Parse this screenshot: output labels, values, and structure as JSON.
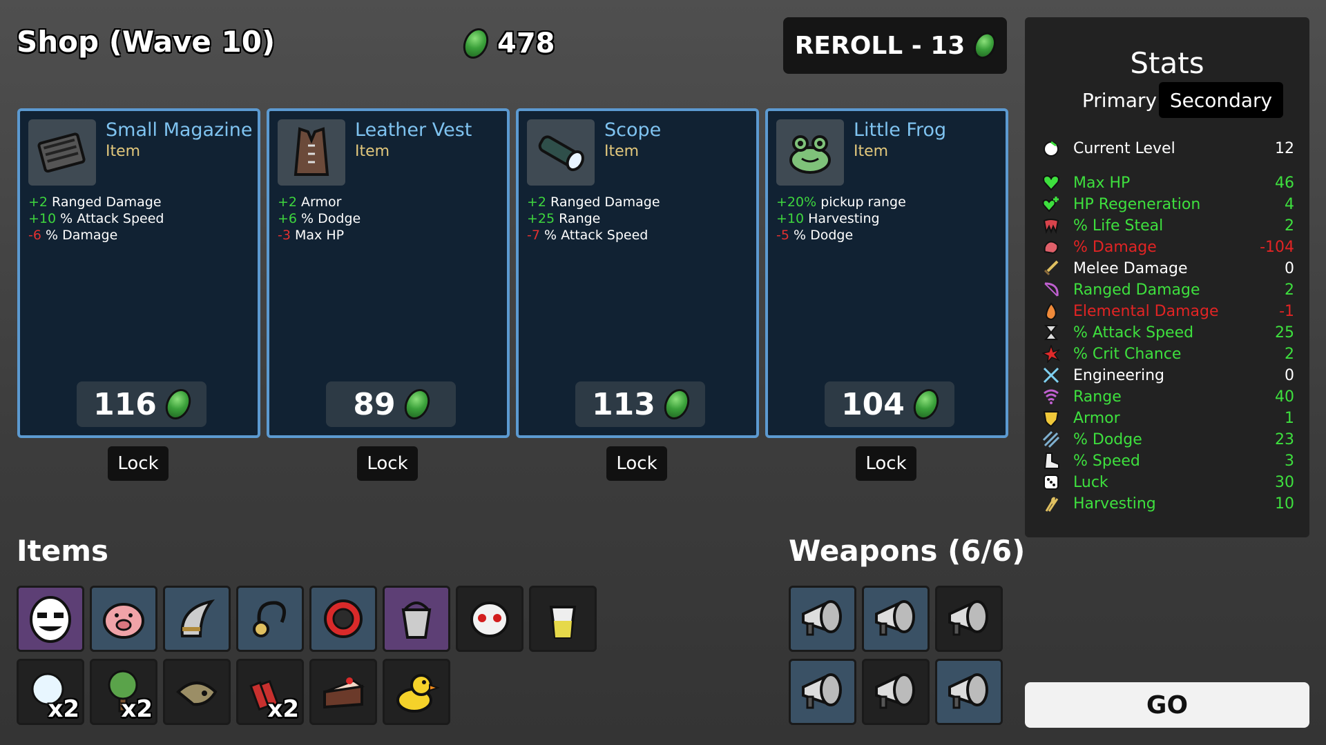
{
  "header": {
    "title": "Shop (Wave 10)",
    "gold": "478",
    "reroll_label": "REROLL - 13"
  },
  "cards": [
    {
      "name": "Small Magazine",
      "type": "Item",
      "price": "116",
      "lock_label": "Lock",
      "icon": "magazine-icon",
      "stats": [
        {
          "value": "+2",
          "sign": "pos",
          "text": " Ranged Damage"
        },
        {
          "value": "+10",
          "sign": "pos",
          "text": " % Attack Speed"
        },
        {
          "value": "-6",
          "sign": "neg",
          "text": " % Damage"
        }
      ]
    },
    {
      "name": "Leather Vest",
      "type": "Item",
      "price": "89",
      "lock_label": "Lock",
      "icon": "vest-icon",
      "stats": [
        {
          "value": "+2",
          "sign": "pos",
          "text": " Armor"
        },
        {
          "value": "+6",
          "sign": "pos",
          "text": " % Dodge"
        },
        {
          "value": "-3",
          "sign": "neg",
          "text": " Max HP"
        }
      ]
    },
    {
      "name": "Scope",
      "type": "Item",
      "price": "113",
      "lock_label": "Lock",
      "icon": "scope-icon",
      "stats": [
        {
          "value": "+2",
          "sign": "pos",
          "text": " Ranged Damage"
        },
        {
          "value": "+25",
          "sign": "pos",
          "text": " Range"
        },
        {
          "value": "-7",
          "sign": "neg",
          "text": " % Attack Speed"
        }
      ]
    },
    {
      "name": "Little Frog",
      "type": "Item",
      "price": "104",
      "lock_label": "Lock",
      "icon": "frog-icon",
      "stats": [
        {
          "value": "+20%",
          "sign": "pos",
          "text": " pickup range"
        },
        {
          "value": "+10",
          "sign": "pos",
          "text": " Harvesting"
        },
        {
          "value": "-5",
          "sign": "neg",
          "text": " % Dodge"
        }
      ]
    }
  ],
  "items_section": {
    "label": "Items",
    "items": [
      {
        "icon": "egg-face-icon",
        "tier": "purple",
        "count": ""
      },
      {
        "icon": "piggy-bank-icon",
        "tier": "blue",
        "count": ""
      },
      {
        "icon": "helmet-icon",
        "tier": "blue",
        "count": ""
      },
      {
        "icon": "pendant-icon",
        "tier": "blue",
        "count": ""
      },
      {
        "icon": "ring-target-icon",
        "tier": "blue",
        "count": ""
      },
      {
        "icon": "bucket-icon",
        "tier": "purple",
        "count": ""
      },
      {
        "icon": "mask-icon",
        "tier": "base",
        "count": ""
      },
      {
        "icon": "cup-icon",
        "tier": "base",
        "count": ""
      },
      {
        "icon": "snowball-icon",
        "tier": "base",
        "count": "x2"
      },
      {
        "icon": "tree-icon",
        "tier": "base",
        "count": "x2"
      },
      {
        "icon": "hat-creature-icon",
        "tier": "base",
        "count": ""
      },
      {
        "icon": "dynamite-icon",
        "tier": "base",
        "count": "x2"
      },
      {
        "icon": "cake-icon",
        "tier": "base",
        "count": ""
      },
      {
        "icon": "duck-icon",
        "tier": "base",
        "count": ""
      }
    ]
  },
  "weapons_section": {
    "label": "Weapons (6/6)",
    "weapons": [
      {
        "icon": "megaphone-gun-icon",
        "tier": "blue"
      },
      {
        "icon": "megaphone-gun-icon",
        "tier": "blue"
      },
      {
        "icon": "megaphone-gun-icon",
        "tier": "base"
      },
      {
        "icon": "megaphone-gun-icon",
        "tier": "blue"
      },
      {
        "icon": "megaphone-gun-icon",
        "tier": "base"
      },
      {
        "icon": "megaphone-gun-icon",
        "tier": "blue"
      }
    ]
  },
  "stats_panel": {
    "title": "Stats",
    "tab_primary": "Primary",
    "tab_secondary": "Secondary",
    "rows": [
      {
        "label": "Current Level",
        "value": "12",
        "color": "white",
        "icon": "level-icon"
      },
      {
        "label": "Max HP",
        "value": "46",
        "color": "green",
        "icon": "heart-icon"
      },
      {
        "label": "HP Regeneration",
        "value": "4",
        "color": "green",
        "icon": "heart-plus-icon"
      },
      {
        "label": "% Life Steal",
        "value": "2",
        "color": "green",
        "icon": "fangs-icon"
      },
      {
        "label": "% Damage",
        "value": "-104",
        "color": "red",
        "icon": "muscle-icon"
      },
      {
        "label": "Melee Damage",
        "value": "0",
        "color": "white",
        "icon": "sword-icon"
      },
      {
        "label": "Ranged Damage",
        "value": "2",
        "color": "green",
        "icon": "bow-icon"
      },
      {
        "label": "Elemental Damage",
        "value": "-1",
        "color": "red",
        "icon": "flame-icon"
      },
      {
        "label": "% Attack Speed",
        "value": "25",
        "color": "green",
        "icon": "hourglass-icon"
      },
      {
        "label": "% Crit Chance",
        "value": "2",
        "color": "green",
        "icon": "crit-icon"
      },
      {
        "label": "Engineering",
        "value": "0",
        "color": "white",
        "icon": "wrench-icon"
      },
      {
        "label": "Range",
        "value": "40",
        "color": "green",
        "icon": "range-icon"
      },
      {
        "label": "Armor",
        "value": "1",
        "color": "green",
        "icon": "shield-icon"
      },
      {
        "label": "% Dodge",
        "value": "23",
        "color": "green",
        "icon": "dodge-icon"
      },
      {
        "label": "% Speed",
        "value": "3",
        "color": "green",
        "icon": "boot-icon"
      },
      {
        "label": "Luck",
        "value": "30",
        "color": "green",
        "icon": "dice-icon"
      },
      {
        "label": "Harvesting",
        "value": "10",
        "color": "green",
        "icon": "wheat-icon"
      }
    ]
  },
  "go_label": "GO",
  "colors": {
    "card_border": "#5c9ad1",
    "card_bg": "#112233",
    "positive": "#3ed63e",
    "negative": "#e23030",
    "item_name": "#7fc3f0",
    "item_type": "#e3c87c"
  }
}
